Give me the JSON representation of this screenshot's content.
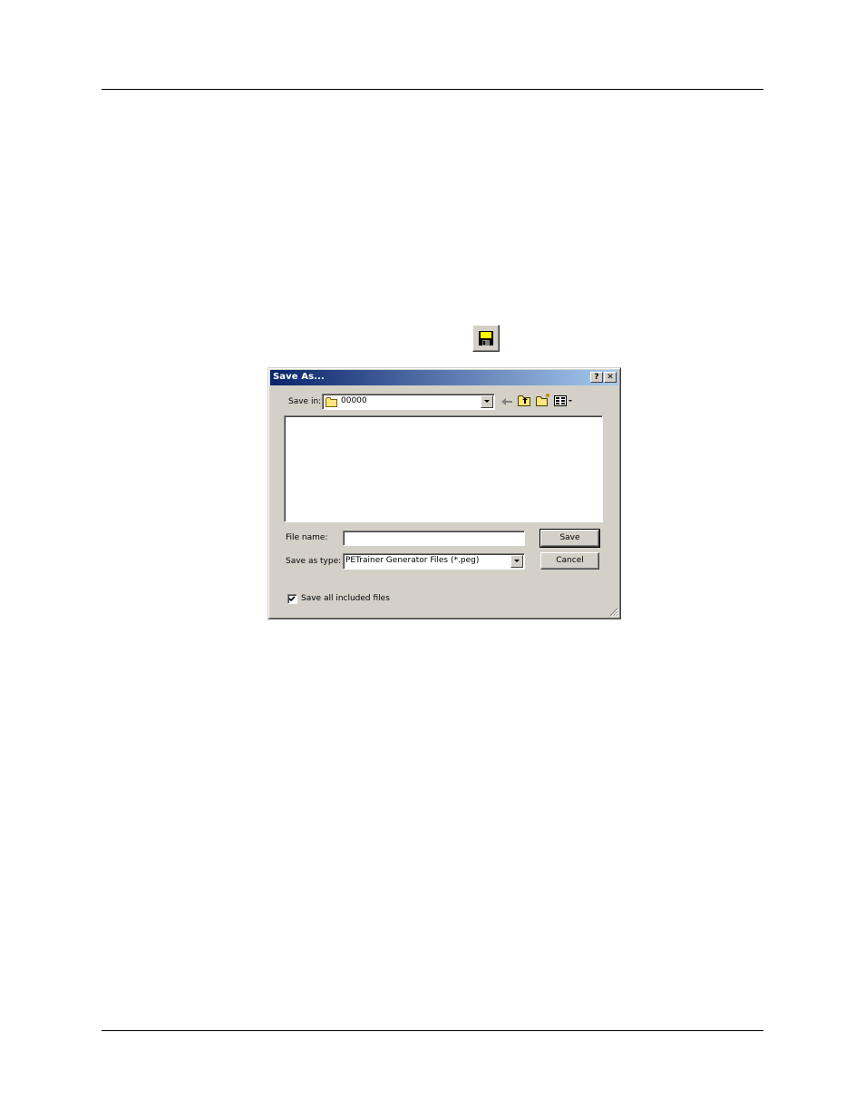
{
  "toolbar": {
    "save_icon": "floppy-disk-icon"
  },
  "dialog": {
    "title": "Save As...",
    "help_glyph": "?",
    "close_glyph": "✕",
    "save_in_label": "Save in:",
    "save_in_value": "00000",
    "file_name_label": "File name:",
    "file_name_value": "",
    "save_as_type_label": "Save as type:",
    "save_as_type_value": "PETrainer Generator Files (*.peg)",
    "save_button": "Save",
    "cancel_button": "Cancel",
    "checkbox_label": "Save all included files",
    "checkbox_checked": true,
    "icons": [
      "back-arrow-icon",
      "up-folder-icon",
      "new-folder-icon",
      "view-menu-icon"
    ]
  },
  "colors": {
    "titlebar_start": "#0a246a",
    "titlebar_end": "#a6caf0",
    "dialog_bg": "#d4d0c8"
  }
}
